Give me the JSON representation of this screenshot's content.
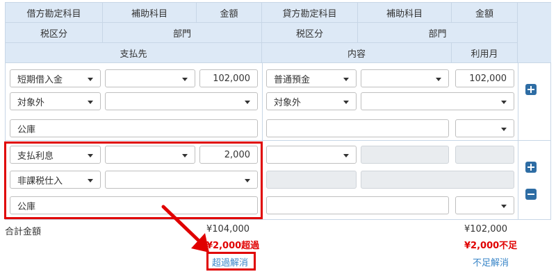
{
  "header": {
    "debit_account": "借方勘定科目",
    "debit_sub": "補助科目",
    "debit_amount": "金額",
    "credit_account": "貸方勘定科目",
    "credit_sub": "補助科目",
    "credit_amount": "金額",
    "debit_tax": "税区分",
    "debit_dept": "部門",
    "credit_tax": "税区分",
    "credit_dept": "部門",
    "payee": "支払先",
    "content": "内容",
    "usage_month": "利用月"
  },
  "rows": [
    {
      "debit_account": "短期借入金",
      "debit_sub": "",
      "debit_amount": "102,000",
      "credit_account": "普通預金",
      "credit_sub": "",
      "credit_amount": "102,000",
      "debit_tax": "対象外",
      "debit_dept": "",
      "credit_tax": "対象外",
      "credit_dept": "",
      "payee": "公庫",
      "content": "",
      "usage_month": ""
    },
    {
      "debit_account": "支払利息",
      "debit_sub": "",
      "debit_amount": "2,000",
      "credit_account": "",
      "credit_sub": "",
      "credit_amount": "",
      "debit_tax": "非課税仕入",
      "debit_dept": "",
      "credit_tax": "",
      "credit_dept": "",
      "payee": "公庫",
      "content": "",
      "usage_month": ""
    }
  ],
  "totals": {
    "label": "合計金額",
    "debit_total": "¥104,000",
    "debit_diff": "¥2,000超過",
    "debit_action": "超過解消",
    "credit_total": "¥102,000",
    "credit_diff": "¥2,000不足",
    "credit_action": "不足解消"
  },
  "colors": {
    "header_bg": "#dde9f6",
    "border": "#c7d6e6",
    "button": "#2e6da4",
    "alert": "#e00000",
    "link": "#3a86c8"
  },
  "icons": [
    "plus-square-icon",
    "minus-square-icon",
    "chevron-down-icon",
    "red-arrow"
  ]
}
